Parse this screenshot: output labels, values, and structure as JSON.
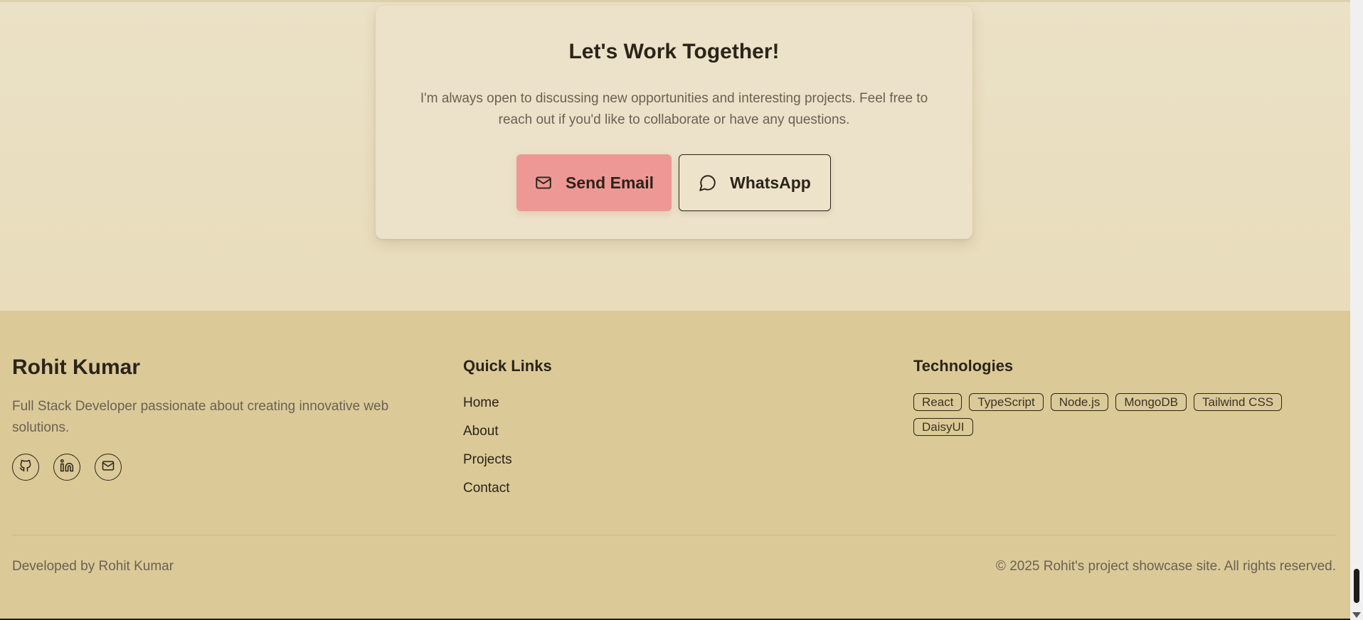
{
  "cta": {
    "title": "Let's Work Together!",
    "text": "I'm always open to discussing new opportunities and interesting projects. Feel free to reach out if you'd like to collaborate or have any questions.",
    "email_label": "Send Email",
    "whatsapp_label": "WhatsApp",
    "email_icon": "mail-icon",
    "whatsapp_icon": "chat-bubble-icon"
  },
  "footer": {
    "brand": {
      "name": "Rohit Kumar",
      "description": "Full Stack Developer passionate about creating innovative web solutions."
    },
    "socials": [
      {
        "name": "github-icon"
      },
      {
        "name": "linkedin-icon"
      },
      {
        "name": "mail-icon"
      }
    ],
    "quick_links": {
      "heading": "Quick Links",
      "items": [
        "Home",
        "About",
        "Projects",
        "Contact"
      ]
    },
    "technologies": {
      "heading": "Technologies",
      "items": [
        "React",
        "TypeScript",
        "Node.js",
        "MongoDB",
        "Tailwind CSS",
        "DaisyUI"
      ]
    },
    "bottom_left": "Developed by Rohit Kumar",
    "bottom_right": "© 2025 Rohit's project showcase site. All rights reserved."
  },
  "colors": {
    "page_bg": "#e8dcbc",
    "card_bg": "#ece2c9",
    "footer_bg": "#dbca98",
    "primary_button": "#ee9896",
    "text_dark": "#2b2419",
    "text_muted": "#6b6151"
  }
}
